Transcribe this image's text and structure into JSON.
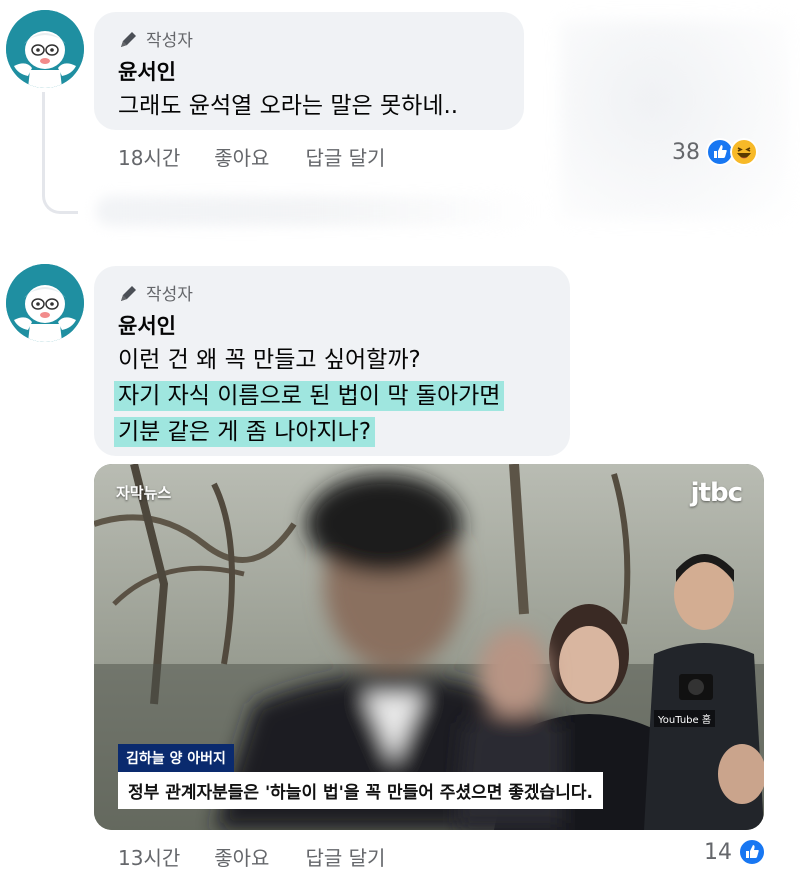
{
  "comments": [
    {
      "author_tag": "작성자",
      "author": "윤서인",
      "lines": [
        "그래도 윤석열 오라는 말은 못하네.."
      ],
      "time": "18시간",
      "like_label": "좋아요",
      "reply_label": "답글 달기",
      "reaction_count": "38",
      "reactions": [
        "like-icon",
        "haha-icon"
      ]
    },
    {
      "author_tag": "작성자",
      "author": "윤서인",
      "lines": [
        "이런 건 왜 꼭 만들고 싶어할까?",
        "자기 자식 이름으로 된 법이 막 돌아가면",
        "기분 같은 게 좀 나아지나?"
      ],
      "highlighted_lines": [
        1,
        2
      ],
      "time": "13시간",
      "like_label": "좋아요",
      "reply_label": "답글 달기",
      "reaction_count": "14",
      "reactions": [
        "like-icon"
      ],
      "attachment": {
        "news_tag": "자막뉴스",
        "channel_logo": "jtbc",
        "speaker_tag": "김하늘 양 아버지",
        "subtitle": "정부 관계자분들은 '하늘이 법'을 꼭 만들어 주셨으면 좋겠습니다.",
        "watermark": "YouTube 홈"
      }
    }
  ],
  "colors": {
    "bubble": "#f0f2f5",
    "highlight": "#9fe6df",
    "like_blue": "#1877f2",
    "haha_yellow": "#f7b928",
    "meta_gray": "#65676b",
    "avatar_teal": "#1f8fa1"
  }
}
